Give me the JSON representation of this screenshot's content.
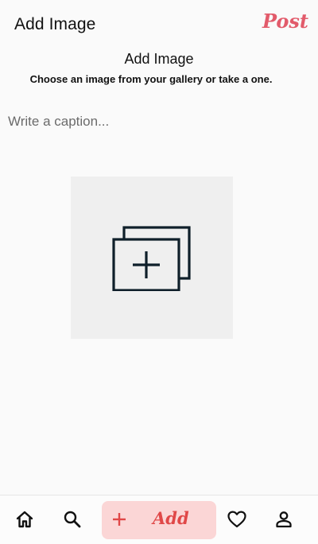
{
  "appbar": {
    "title": "Add Image",
    "post_label": "Post"
  },
  "main": {
    "heading": "Add Image",
    "subheading": "Choose an image from your gallery or take a one.",
    "caption_placeholder": "Write a caption...",
    "caption_value": "",
    "picker_icon": "add-photo-collection-icon"
  },
  "bottom_nav": {
    "items": [
      {
        "icon": "home-icon"
      },
      {
        "icon": "search-icon"
      },
      {
        "icon": "plus-icon",
        "label": "Add"
      },
      {
        "icon": "heart-icon"
      },
      {
        "icon": "person-icon"
      }
    ]
  },
  "colors": {
    "accent": "#e25b6b",
    "add_pill_bg": "#fbd6d6",
    "add_text": "#e04848",
    "picker_bg": "#efefef",
    "icon_stroke": "#0f1f2a"
  }
}
